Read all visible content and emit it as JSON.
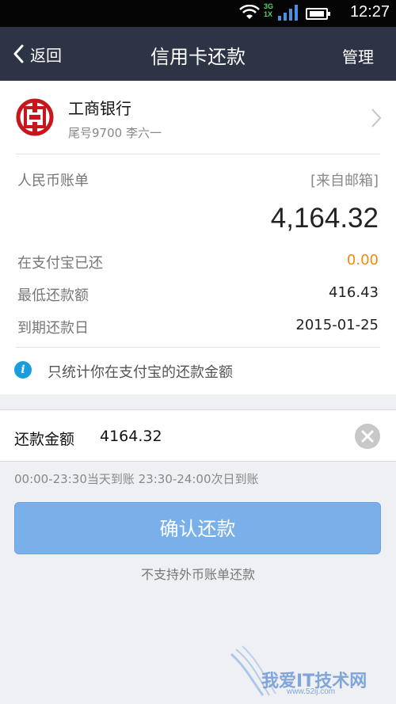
{
  "status_bar": {
    "network": "3G",
    "network2": "1X",
    "time": "12:27"
  },
  "nav": {
    "back_label": "返回",
    "title": "信用卡还款",
    "manage_label": "管理"
  },
  "bank": {
    "name": "工商银行",
    "tail_holder": "尾号9700 李六一"
  },
  "bill": {
    "label": "人民币账单",
    "source": "[来自邮箱]",
    "amount": "4,164.32",
    "rows": [
      {
        "label": "在支付宝已还",
        "value": "0.00"
      },
      {
        "label": "最低还款额",
        "value": "416.43"
      },
      {
        "label": "到期还款日",
        "value": "2015-01-25"
      }
    ],
    "tip": "只统计你在支付宝的还款金额"
  },
  "repay": {
    "label": "还款金额",
    "value": "4164.32"
  },
  "arrival_note": "00:00-23:30当天到账  23:30-24:00次日到账",
  "confirm_label": "确认还款",
  "notice": "不支持外币账单还款",
  "watermark": {
    "text": "我爱IT技术网",
    "url": "www.52ij.com"
  },
  "colors": {
    "navbar": "#2c3446",
    "button": "#7ab0ea",
    "orange": "#ef8a12",
    "info": "#1a9ddb",
    "bank_red": "#c8161d"
  }
}
